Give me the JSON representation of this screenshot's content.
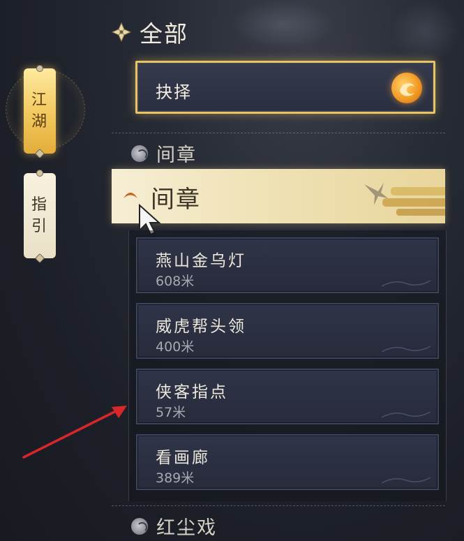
{
  "header": {
    "title": "全部",
    "icon": "diamond-flower-icon"
  },
  "side_tabs": [
    {
      "label_line1": "江",
      "label_line2": "湖",
      "active": true
    },
    {
      "label_line1": "指",
      "label_line2": "引",
      "active": false
    }
  ],
  "selected_card": {
    "label": "抉择",
    "icon": "orange-orb-icon"
  },
  "sections": {
    "collapsed_top": "间章",
    "expanded": "间章",
    "collapsed_bottom": "红尘戏"
  },
  "quests": [
    {
      "name": "燕山金乌灯",
      "distance": "608米"
    },
    {
      "name": "威虎帮头领",
      "distance": "400米"
    },
    {
      "name": "侠客指点",
      "distance": "57米"
    },
    {
      "name": "看画廊",
      "distance": "389米"
    }
  ],
  "colors": {
    "accent_gold": "#e8c465",
    "annotation_arrow": "#d8262a"
  }
}
